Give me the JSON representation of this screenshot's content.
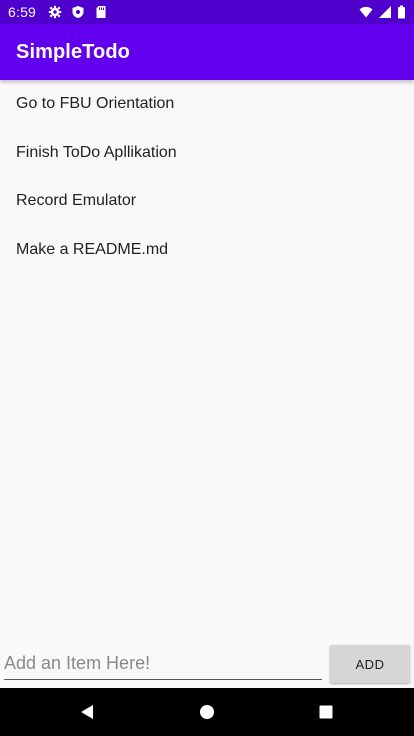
{
  "status_bar": {
    "time": "6:59",
    "left_icons": [
      "gear-icon",
      "shield-icon",
      "sd-card-icon"
    ],
    "right_icons": [
      "wifi-icon",
      "cell-signal-icon",
      "battery-icon"
    ],
    "color": "#4f00cc"
  },
  "app_bar": {
    "title": "SimpleTodo",
    "color": "#6200ee"
  },
  "todo": {
    "items": [
      "Go to FBU Orientation",
      "Finish ToDo Apllikation",
      "Record Emulator",
      "Make a README.md"
    ]
  },
  "input": {
    "value": "",
    "placeholder": "Add an Item Here!"
  },
  "add_button": {
    "label": "ADD"
  },
  "nav_bar": {
    "buttons": [
      "back-icon",
      "home-icon",
      "recents-icon"
    ]
  }
}
